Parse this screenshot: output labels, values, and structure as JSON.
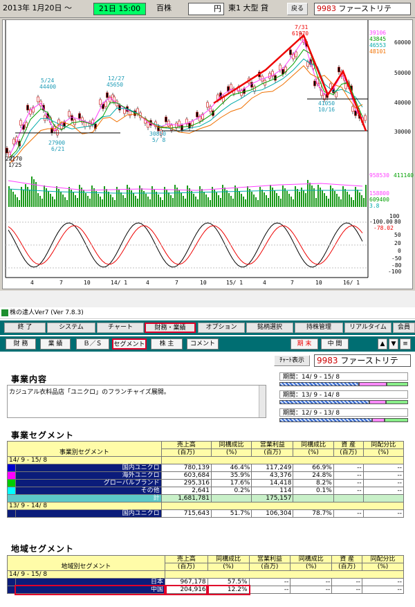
{
  "toolbar": {
    "date": "2013年 1月20日 ～",
    "time": "21日 15:00",
    "unit": "百株",
    "currency": "円",
    "market": "東1 大型 貸",
    "back": "戻る",
    "code": "9983",
    "name": "ファーストリテ"
  },
  "chart": {
    "legend_ma": [
      "39106",
      "43845",
      "46553",
      "48101"
    ],
    "legend_vol": [
      "958530",
      "411140"
    ],
    "legend_vol2": [
      "158800",
      "609400",
      "3.8"
    ],
    "yticks_price": [
      "60000",
      "50000",
      "40000",
      "30000"
    ],
    "yticks_osc": [
      "100",
      "80",
      "50",
      "20",
      "0",
      "-50",
      "-80",
      "-100"
    ],
    "osc_vals": [
      "-100.00",
      "-78.02"
    ],
    "xticks": [
      "4",
      "7",
      "10",
      "14/ 1",
      "4",
      "7",
      "10",
      "15/ 1",
      "4",
      "7",
      "10",
      "16/ 1"
    ],
    "annotations": [
      {
        "t": "7/31"
      },
      {
        "t": "61970"
      },
      {
        "t": "5/24"
      },
      {
        "t": "44400"
      },
      {
        "t": "12/27"
      },
      {
        "t": "45650"
      },
      {
        "t": "27900"
      },
      {
        "t": "6/21"
      },
      {
        "t": "30850"
      },
      {
        "t": "5/ 8"
      },
      {
        "t": "22270"
      },
      {
        "t": "1/25"
      },
      {
        "t": "41050"
      },
      {
        "t": "10/16"
      }
    ]
  },
  "window": {
    "title": "株の達人Ver7 (Ver 7.8.3)",
    "menu": [
      "終 了",
      "システム",
      "チャート",
      "財務・業績",
      "オプション",
      "銘柄選択",
      "持株管理",
      "リアルタイム",
      "会員"
    ],
    "submenu": [
      "財 務",
      "業 績",
      "Ｂ／Ｓ",
      "セグメント",
      "株 主",
      "コメント"
    ],
    "period_buttons": [
      "期 末",
      "中 間"
    ],
    "chart_btn": "ﾁｬｰﾄ表示",
    "code": "9983",
    "name": "ファーストリテ",
    "business_heading": "事業内容",
    "business_text": "カジュアル衣料品店「ユニクロ」のフランチャイズ展開。",
    "periods": [
      "期間：14/ 9 - 15/ 8",
      "期間：13/ 9 - 14/ 8",
      "期間：12/ 9 - 13/ 8"
    ]
  },
  "seg1": {
    "title": "事業セグメント",
    "headers": [
      [
        "売上高",
        "(百万)"
      ],
      [
        "同構成比",
        "(%)"
      ],
      [
        "営業利益",
        "(百万)"
      ],
      [
        "同構成比",
        "(%)"
      ],
      [
        "資 産",
        "(百万)"
      ],
      [
        "同配分比",
        "(%)"
      ]
    ],
    "rowhead": "事業別セグメント",
    "period1": "14/ 9 - 15/ 8",
    "rows": [
      {
        "name": "国内ユニクロ",
        "color": "#0000cc",
        "v": [
          "780,139",
          "46.4%",
          "117,249",
          "66.9%",
          "--",
          "--"
        ]
      },
      {
        "name": "海外ユニクロ",
        "color": "#ff00ff",
        "v": [
          "603,684",
          "35.9%",
          "43,376",
          "24.8%",
          "--",
          "--"
        ]
      },
      {
        "name": "グローバルブランド",
        "color": "#00cc00",
        "v": [
          "295,316",
          "17.6%",
          "14,418",
          "8.2%",
          "--",
          "--"
        ]
      },
      {
        "name": "その他",
        "color": "#00ffff",
        "v": [
          "2,641",
          "0.2%",
          "114",
          "0.1%",
          "--",
          "--"
        ]
      }
    ],
    "total": {
      "name": "計",
      "v": [
        "1,681,781",
        "",
        "175,157",
        "",
        "",
        ""
      ]
    },
    "period2": "13/ 9 - 14/ 8",
    "row2": {
      "name": "国内ユニクロ",
      "v": [
        "715,643",
        "51.7%",
        "106,304",
        "78.7%",
        "--",
        "--"
      ]
    }
  },
  "seg2": {
    "title": "地域セグメント",
    "headers": [
      [
        "売上高",
        "(百万)"
      ],
      [
        "同構成比",
        "(%)"
      ],
      [
        "営業利益",
        "(百万)"
      ],
      [
        "同構成比",
        "(%)"
      ],
      [
        "資 産",
        "(百万)"
      ],
      [
        "同配分比",
        "(%)"
      ]
    ],
    "rowhead": "地域別セグメント",
    "period1": "14/ 9 - 15/ 8",
    "rows": [
      {
        "name": "日本",
        "v": [
          "967,178",
          "57.5%",
          "--",
          "--",
          "--",
          "--"
        ]
      },
      {
        "name": "中国",
        "v": [
          "204,916",
          "12.2%",
          "--",
          "--",
          "--",
          "--"
        ]
      }
    ]
  }
}
